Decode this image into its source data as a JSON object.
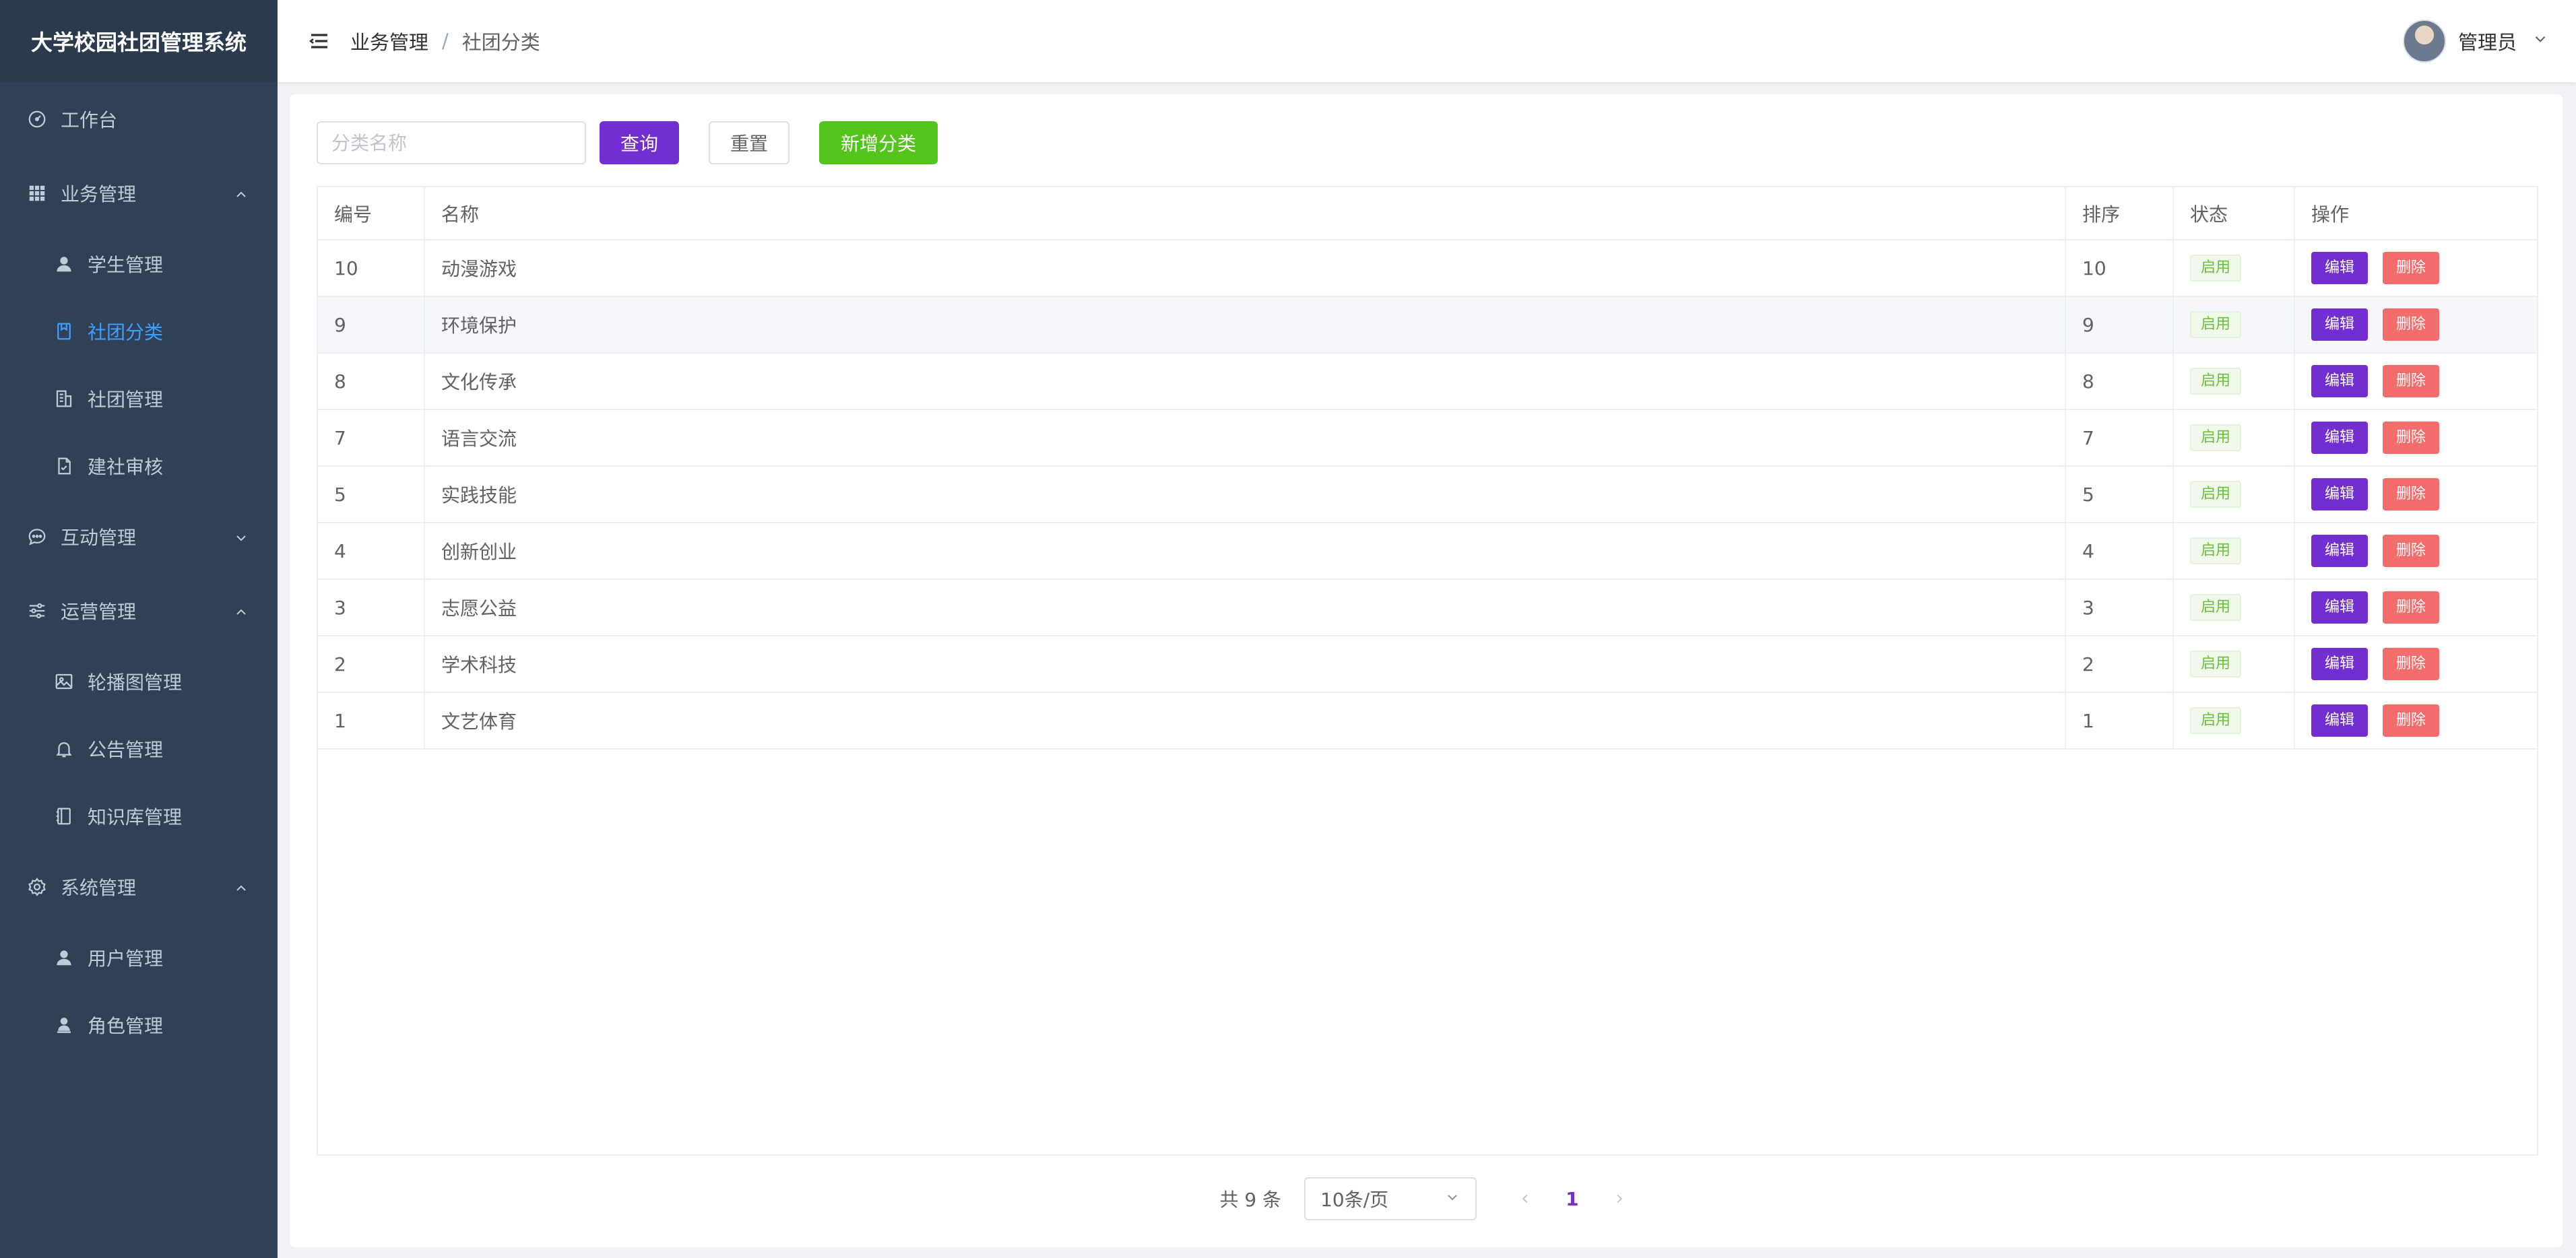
{
  "app": {
    "title": "大学校园社团管理系统"
  },
  "sidebar": {
    "items": [
      {
        "label": "工作台",
        "icon": "dashboard-icon",
        "level": "top"
      },
      {
        "label": "业务管理",
        "icon": "grid-icon",
        "level": "top",
        "expanded": true
      },
      {
        "label": "学生管理",
        "icon": "user-icon",
        "level": "sub"
      },
      {
        "label": "社团分类",
        "icon": "bookmark-icon",
        "level": "sub",
        "active": true
      },
      {
        "label": "社团管理",
        "icon": "building-icon",
        "level": "sub"
      },
      {
        "label": "建社审核",
        "icon": "document-icon",
        "level": "sub"
      },
      {
        "label": "互动管理",
        "icon": "chat-icon",
        "level": "top",
        "expanded": false
      },
      {
        "label": "运营管理",
        "icon": "sliders-icon",
        "level": "top",
        "expanded": true
      },
      {
        "label": "轮播图管理",
        "icon": "image-icon",
        "level": "sub"
      },
      {
        "label": "公告管理",
        "icon": "bell-icon",
        "level": "sub"
      },
      {
        "label": "知识库管理",
        "icon": "notebook-icon",
        "level": "sub"
      },
      {
        "label": "系统管理",
        "icon": "gear-icon",
        "level": "top",
        "expanded": true
      },
      {
        "label": "用户管理",
        "icon": "user-icon",
        "level": "sub"
      },
      {
        "label": "角色管理",
        "icon": "role-icon",
        "level": "sub"
      }
    ]
  },
  "header": {
    "breadcrumb": [
      "业务管理",
      "社团分类"
    ],
    "separator": "/",
    "user": "管理员"
  },
  "toolbar": {
    "search_placeholder": "分类名称",
    "query_label": "查询",
    "reset_label": "重置",
    "add_label": "新增分类"
  },
  "table": {
    "columns": [
      "编号",
      "名称",
      "排序",
      "状态",
      "操作"
    ],
    "edit_label": "编辑",
    "delete_label": "删除",
    "rows": [
      {
        "id": "10",
        "name": "动漫游戏",
        "sort": "10",
        "status": "启用"
      },
      {
        "id": "9",
        "name": "环境保护",
        "sort": "9",
        "status": "启用"
      },
      {
        "id": "8",
        "name": "文化传承",
        "sort": "8",
        "status": "启用"
      },
      {
        "id": "7",
        "name": "语言交流",
        "sort": "7",
        "status": "启用"
      },
      {
        "id": "5",
        "name": "实践技能",
        "sort": "5",
        "status": "启用"
      },
      {
        "id": "4",
        "name": "创新创业",
        "sort": "4",
        "status": "启用"
      },
      {
        "id": "3",
        "name": "志愿公益",
        "sort": "3",
        "status": "启用"
      },
      {
        "id": "2",
        "name": "学术科技",
        "sort": "2",
        "status": "启用"
      },
      {
        "id": "1",
        "name": "文艺体育",
        "sort": "1",
        "status": "启用"
      }
    ]
  },
  "pagination": {
    "total_text": "共 9 条",
    "page_size": "10条/页",
    "current_page": "1"
  },
  "colors": {
    "sidebar_bg": "#304156",
    "active_menu": "#409eff",
    "primary": "#722ed1",
    "success": "#52c41a",
    "danger": "#f56c6c"
  }
}
